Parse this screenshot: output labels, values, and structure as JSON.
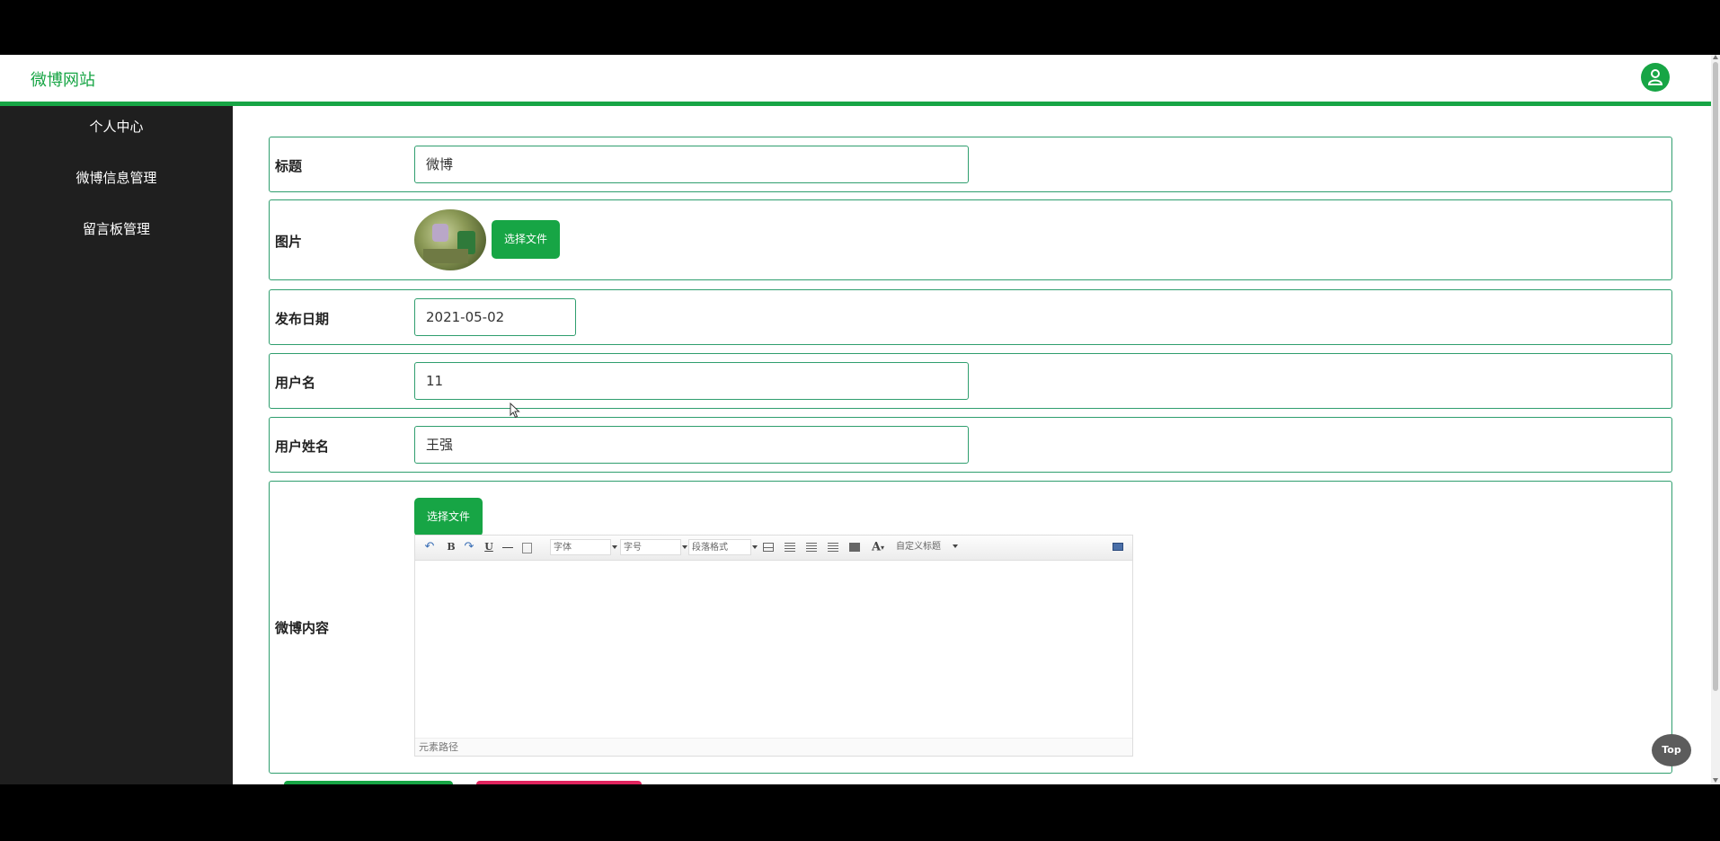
{
  "header": {
    "site_title": "微博网站",
    "avatar_icon": "user-icon"
  },
  "sidebar": {
    "items": [
      {
        "label": "个人中心"
      },
      {
        "label": "微博信息管理"
      },
      {
        "label": "留言板管理"
      }
    ]
  },
  "form": {
    "title": {
      "label": "标题",
      "value": "微博"
    },
    "image": {
      "label": "图片",
      "button": "选择文件"
    },
    "publish_date": {
      "label": "发布日期",
      "value": "2021-05-02"
    },
    "username": {
      "label": "用户名",
      "value": "11"
    },
    "real_name": {
      "label": "用户姓名",
      "value": "王强"
    },
    "content": {
      "label": "微博内容",
      "button": "选择文件",
      "toolbar": {
        "bold": "B",
        "underline": "U",
        "font_family": "字体",
        "font_size": "字号",
        "paragraph": "段落格式",
        "font_color": "A",
        "custom_title": "自定义标题"
      },
      "status": "元素路径"
    }
  },
  "top_button": "Top",
  "colors": {
    "accent": "#17a545",
    "sidebar": "#1f1f1f",
    "danger": "#e0245e"
  }
}
